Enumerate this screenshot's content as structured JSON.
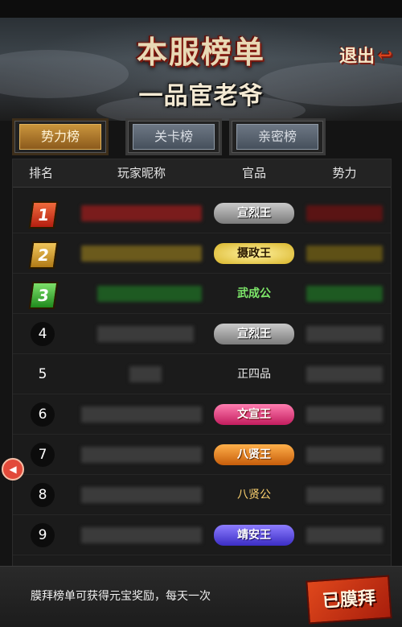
{
  "header": {
    "title": "本服榜单",
    "subtitle": "一品宦老爷",
    "exit_label": "退出"
  },
  "tabs": [
    {
      "label": "势力榜",
      "active": true
    },
    {
      "label": "关卡榜",
      "active": false
    },
    {
      "label": "亲密榜",
      "active": false
    }
  ],
  "table": {
    "headers": {
      "rank": "排名",
      "name": "玩家昵称",
      "title": "官品",
      "power": "势力"
    },
    "rows": [
      {
        "rank": "1",
        "title": "宣烈王",
        "style": "red"
      },
      {
        "rank": "2",
        "title": "摄政王",
        "style": "gold"
      },
      {
        "rank": "3",
        "title": "武成公",
        "style": "green"
      },
      {
        "rank": "4",
        "title": "宣烈王",
        "style": "circle"
      },
      {
        "rank": "5",
        "title": "正四品",
        "style": "plain"
      },
      {
        "rank": "6",
        "title": "文宣王",
        "style": "circle"
      },
      {
        "rank": "7",
        "title": "八贤王",
        "style": "circle"
      },
      {
        "rank": "8",
        "title": "八贤公",
        "style": "circle"
      },
      {
        "rank": "9",
        "title": "靖安王",
        "style": "circle"
      }
    ]
  },
  "footer": {
    "info": "膜拜榜单可获得元宝奖励，每天一次",
    "button_label": "已膜拜"
  }
}
